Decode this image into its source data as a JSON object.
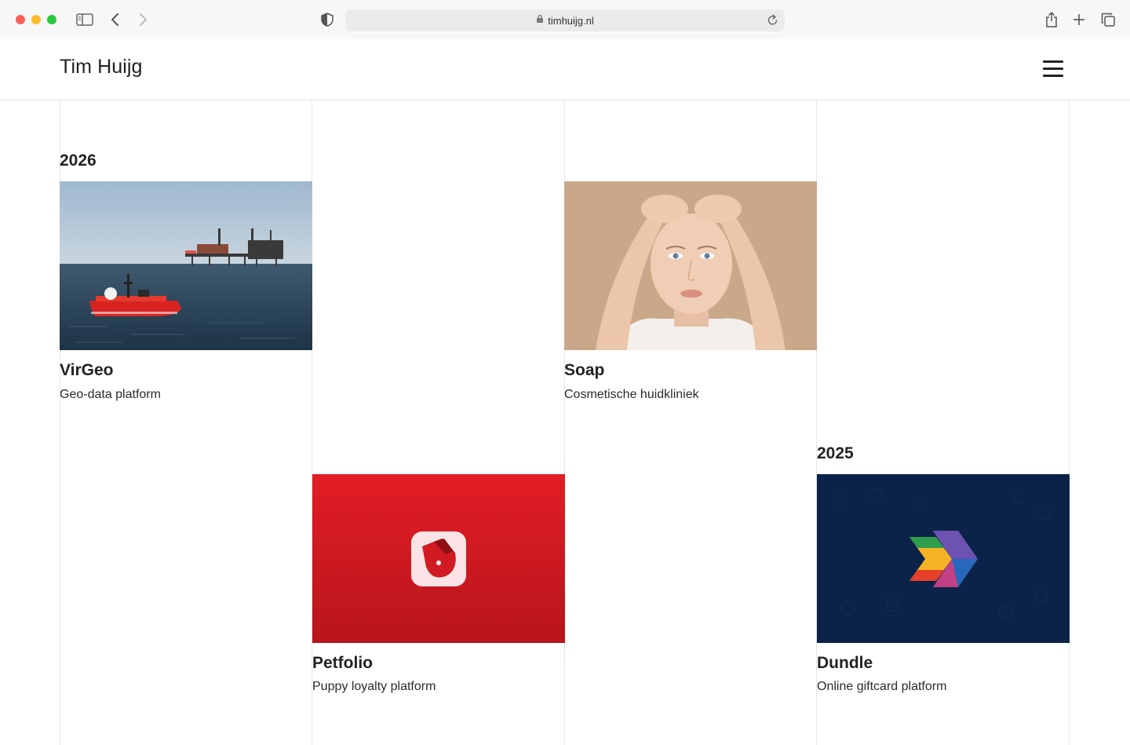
{
  "browser": {
    "url": "timhuijg.nl"
  },
  "site": {
    "title": "Tim Huijg"
  },
  "years": {
    "first": "2026",
    "second": "2025"
  },
  "projects": [
    {
      "title": "VirGeo",
      "subtitle": "Geo-data platform"
    },
    {
      "title": "Soap",
      "subtitle": "Cosmetische huidkliniek"
    },
    {
      "title": "Petfolio",
      "subtitle": "Puppy loyalty platform"
    },
    {
      "title": "Dundle",
      "subtitle": "Online giftcard platform"
    }
  ],
  "icons": [
    "sidebar-icon",
    "back-icon",
    "forward-icon",
    "shield-icon",
    "lock-icon",
    "reload-icon",
    "share-icon",
    "new-tab-icon",
    "tabs-icon",
    "hamburger-menu-icon"
  ],
  "colors": {
    "petfolio_red": "#d81c24",
    "dundle_navy": "#0b2348"
  }
}
